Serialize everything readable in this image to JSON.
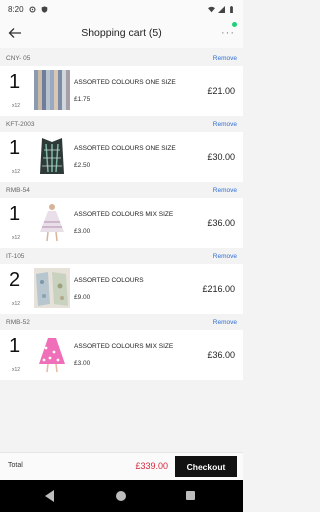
{
  "status": {
    "time": "8:20",
    "icons": [
      "settings-gear-icon",
      "shield-icon",
      "wifi-icon",
      "signal-icon",
      "battery-icon"
    ]
  },
  "header": {
    "title": "Shopping cart (5)",
    "more": "···"
  },
  "remove_label": "Remove",
  "items": [
    {
      "sku": "CNY- 05",
      "qty": "1",
      "multiplier": "x12",
      "name": "ASSORTED COLOURS ONE SIZE",
      "unit_price": "£1.75",
      "line_total": "£21.00"
    },
    {
      "sku": "KFT-2003",
      "qty": "1",
      "multiplier": "x12",
      "name": "ASSORTED COLOURS ONE SIZE",
      "unit_price": "£2.50",
      "line_total": "£30.00"
    },
    {
      "sku": "RMB-54",
      "qty": "1",
      "multiplier": "x12",
      "name": "ASSORTED COLOURS MIX SIZE",
      "unit_price": "£3.00",
      "line_total": "£36.00"
    },
    {
      "sku": "IT-105",
      "qty": "2",
      "multiplier": "x12",
      "name": "ASSORTED COLOURS",
      "unit_price": "£9.00",
      "line_total": "£216.00"
    },
    {
      "sku": "RMB-52",
      "qty": "1",
      "multiplier": "x12",
      "name": "ASSORTED COLOURS MIX SIZE",
      "unit_price": "£3.00",
      "line_total": "£36.00"
    }
  ],
  "footer": {
    "total_label": "Total",
    "total_value": "£339.00",
    "checkout_label": "Checkout"
  },
  "colors": {
    "accent_link": "#2f6fd2",
    "total_price": "#d4293f",
    "checkout_bg": "#111111"
  }
}
